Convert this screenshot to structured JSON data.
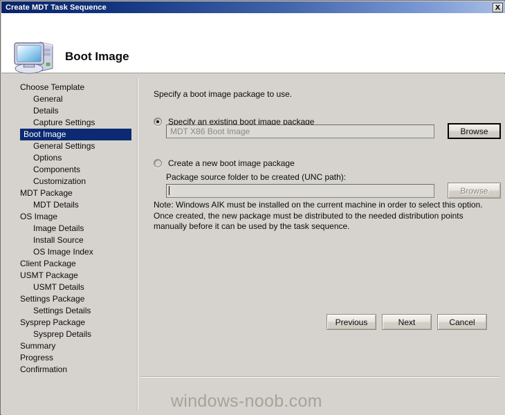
{
  "window": {
    "title": "Create MDT Task Sequence",
    "close_label": "Close"
  },
  "header": {
    "title": "Boot Image",
    "icon": "computer-icon"
  },
  "sidebar": {
    "items": [
      {
        "label": "Choose Template",
        "level": 0,
        "selected": false
      },
      {
        "label": "General",
        "level": 1,
        "selected": false
      },
      {
        "label": "Details",
        "level": 1,
        "selected": false
      },
      {
        "label": "Capture Settings",
        "level": 1,
        "selected": false
      },
      {
        "label": "Boot Image",
        "level": 0,
        "selected": true
      },
      {
        "label": "General Settings",
        "level": 1,
        "selected": false
      },
      {
        "label": "Options",
        "level": 1,
        "selected": false
      },
      {
        "label": "Components",
        "level": 1,
        "selected": false
      },
      {
        "label": "Customization",
        "level": 1,
        "selected": false
      },
      {
        "label": "MDT Package",
        "level": 0,
        "selected": false
      },
      {
        "label": "MDT Details",
        "level": 1,
        "selected": false
      },
      {
        "label": "OS Image",
        "level": 0,
        "selected": false
      },
      {
        "label": "Image Details",
        "level": 1,
        "selected": false
      },
      {
        "label": "Install Source",
        "level": 1,
        "selected": false
      },
      {
        "label": "OS Image Index",
        "level": 1,
        "selected": false
      },
      {
        "label": "Client Package",
        "level": 0,
        "selected": false
      },
      {
        "label": "USMT Package",
        "level": 0,
        "selected": false
      },
      {
        "label": "USMT Details",
        "level": 1,
        "selected": false
      },
      {
        "label": "Settings Package",
        "level": 0,
        "selected": false
      },
      {
        "label": "Settings Details",
        "level": 1,
        "selected": false
      },
      {
        "label": "Sysprep Package",
        "level": 0,
        "selected": false
      },
      {
        "label": "Sysprep Details",
        "level": 1,
        "selected": false
      },
      {
        "label": "Summary",
        "level": 0,
        "selected": false
      },
      {
        "label": "Progress",
        "level": 0,
        "selected": false
      },
      {
        "label": "Confirmation",
        "level": 0,
        "selected": false
      }
    ]
  },
  "main": {
    "intro": "Specify a boot image package to use.",
    "option_existing": {
      "label": "Specify an existing boot image package",
      "checked": true,
      "value": "MDT X86 Boot Image",
      "browse_label": "Browse"
    },
    "option_new": {
      "label": "Create a new boot image package",
      "checked": false,
      "field_label": "Package source folder to be created (UNC path):",
      "value": "",
      "browse_label": "Browse"
    },
    "note": "Note: Windows AIK must be installed on the current machine in order to select this option.  Once created, the new package must be distributed to the needed distribution points manually before it can be used by the task sequence."
  },
  "footer": {
    "previous_label": "Previous",
    "next_label": "Next",
    "cancel_label": "Cancel"
  },
  "watermark": {
    "text": "windows-noob.com"
  }
}
